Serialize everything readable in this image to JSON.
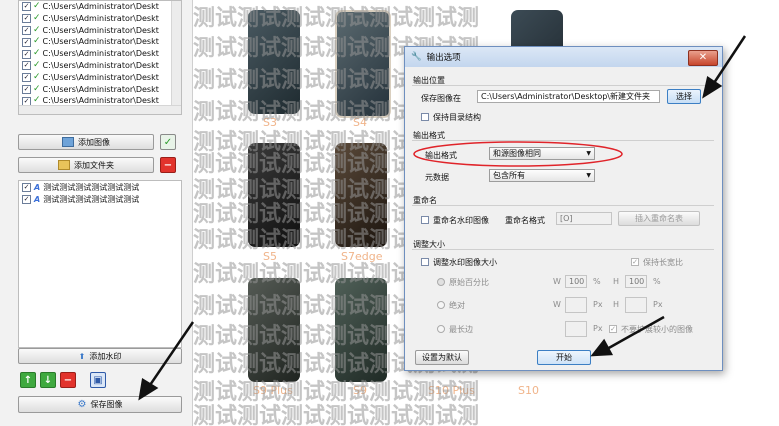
{
  "left_panel": {
    "files": [
      "C:\\Users\\Administrator\\Deskt",
      "C:\\Users\\Administrator\\Deskt",
      "C:\\Users\\Administrator\\Deskt",
      "C:\\Users\\Administrator\\Deskt",
      "C:\\Users\\Administrator\\Deskt",
      "C:\\Users\\Administrator\\Deskt",
      "C:\\Users\\Administrator\\Deskt",
      "C:\\Users\\Administrator\\Deskt",
      "C:\\Users\\Administrator\\Deskt"
    ],
    "add_image_label": "添加图像",
    "add_folder_label": "添加文件夹",
    "watermarks": [
      "测试测试测试测试测试测试",
      "测试测试测试测试测试测试"
    ],
    "add_watermark_label": "添加水印",
    "save_image_label": "保存图像"
  },
  "preview": {
    "watermark_text": "测试测试测试测试测试测试测",
    "captions": [
      "S3",
      "S4",
      "S5",
      "S7edge",
      "S9 Plus",
      "S9",
      "S10 Plus",
      "S10"
    ]
  },
  "dialog": {
    "title": "输出选项",
    "close_label": "✕",
    "output_location": {
      "group_title": "输出位置",
      "save_to_label": "保存图像在",
      "path": "C:\\Users\\Administrator\\Desktop\\新建文件夹",
      "browse_label": "选择",
      "keep_structure_label": "保持目录结构"
    },
    "output_format": {
      "group_title": "输出格式",
      "format_label": "输出格式",
      "format_value": "和源图像相同",
      "metadata_label": "元数据",
      "metadata_value": "包含所有"
    },
    "rename": {
      "group_title": "重命名",
      "rename_label": "重命名水印图像",
      "format_label": "重命名格式",
      "format_value": "[O]",
      "insert_label": "插入重命名表"
    },
    "resize": {
      "group_title": "调整大小",
      "resize_label": "调整水印图像大小",
      "keep_ratio_label": "保持长宽比",
      "percent_label": "原始百分比",
      "w_label": "W",
      "h_label": "H",
      "w_percent": "100",
      "h_percent": "100",
      "percent_unit": "%",
      "absolute_label": "绝对",
      "px_unit": "Px",
      "long_side_label": "最长边",
      "no_enlarge_label": "不要扩展较小的图像"
    },
    "set_default_label": "设置为默认",
    "start_label": "开始"
  },
  "colors": {
    "highlight_ellipse": "#e0242a",
    "caption": "#f0b48a"
  }
}
